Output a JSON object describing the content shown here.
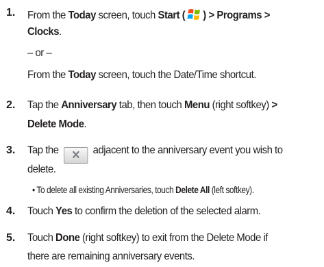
{
  "steps": {
    "s1": {
      "num": "1.",
      "a": "From the ",
      "today": "Today",
      "b": " screen, touch ",
      "start": "Start",
      "paren_open": " (",
      "paren_close": ") ",
      "path1": "> Programs >",
      "path2": "Clocks",
      "dot": ".",
      "or": "– or –",
      "alt_a": "From the ",
      "alt_today": "Today",
      "alt_b": " screen, touch the Date/Time shortcut."
    },
    "s2": {
      "num": "2.",
      "a": "Tap the ",
      "anniv": "Anniversary",
      "b": " tab, then touch ",
      "menu": "Menu",
      "c": " (right softkey) ",
      "gt": ">",
      "delmode": "Delete Mode",
      "dot": "."
    },
    "s3": {
      "num": "3.",
      "a": "Tap the ",
      "b": " adjacent to the anniversary event you wish to",
      "c": "delete.",
      "bullet": "•",
      "sub_a": " To delete all existing Anniversaries, touch ",
      "delall": "Delete All",
      "sub_b": " (left softkey)."
    },
    "s4": {
      "num": "4.",
      "a": "Touch ",
      "yes": "Yes",
      "b": " to confirm the deletion of the selected alarm."
    },
    "s5": {
      "num": "5.",
      "a": "Touch ",
      "done": "Done",
      "b": " (right softkey) to exit from the Delete Mode if",
      "c": "there are remaining anniversary events."
    }
  },
  "icons": {
    "start": "windows-start-icon",
    "delete": "delete-x-icon",
    "delete_glyph": "✕"
  }
}
